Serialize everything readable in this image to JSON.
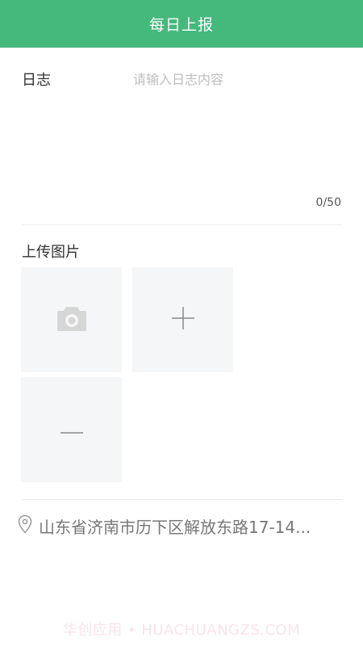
{
  "header": {
    "title": "每日上报"
  },
  "log": {
    "label": "日志",
    "placeholder": "请输入日志内容",
    "value": "",
    "counter": "0/50"
  },
  "upload": {
    "label": "上传图片",
    "tiles": [
      {
        "icon": "camera-icon"
      },
      {
        "icon": "plus-icon"
      },
      {
        "icon": "minus-icon"
      }
    ]
  },
  "location": {
    "icon": "location-pin-icon",
    "address": "山东省济南市历下区解放东路17-14..."
  },
  "watermark": "华创应用 • HUACHUANGZS.COM"
}
